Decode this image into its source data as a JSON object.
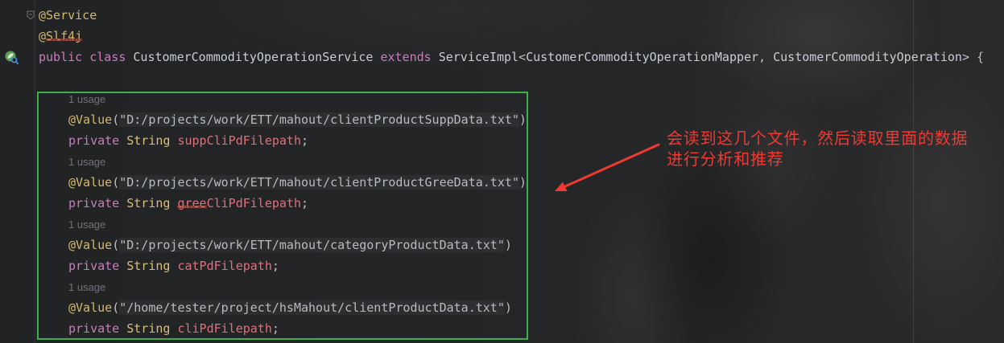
{
  "punct": {
    "lparen": "(",
    "rparen": ")",
    "semicolon": ";",
    "lt": "<",
    "gt": ">",
    "comma": ","
  },
  "header": {
    "annotation_service": "@Service",
    "annotation_slf4j": "@Slf4j",
    "kw_public": "public",
    "kw_class": "class",
    "class_name": "CustomerCommodityOperationService",
    "kw_extends": "extends",
    "super_class": "ServiceImpl",
    "type_arg_mapper": "CustomerCommodityOperationMapper",
    "type_arg_entity": "CustomerCommodityOperation",
    "open_brace": "{"
  },
  "fields": [
    {
      "usage": "1 usage",
      "annotation": "@Value",
      "value_literal": "\"D:/projects/work/ETT/mahout/clientProductSuppData.txt\"",
      "modifier": "private",
      "type": "String",
      "name": "suppCliPdFilepath"
    },
    {
      "usage": "1 usage",
      "annotation": "@Value",
      "value_literal": "\"D:/projects/work/ETT/mahout/clientProductGreeData.txt\"",
      "modifier": "private",
      "type": "String",
      "name": "greeCliPdFilepath"
    },
    {
      "usage": "1 usage",
      "annotation": "@Value",
      "value_literal": "\"D:/projects/work/ETT/mahout/categoryProductData.txt\"",
      "modifier": "private",
      "type": "String",
      "name": "catPdFilepath"
    },
    {
      "usage": "1 usage",
      "annotation": "@Value",
      "value_literal": "\"/home/tester/project/hsMahout/clientProductData.txt\"",
      "modifier": "private",
      "type": "String",
      "name": "cliPdFilepath"
    }
  ],
  "callout": {
    "line1": "会读到这几个文件，然后读取里面的数据",
    "line2": "进行分析和推荐"
  },
  "icons": {
    "gutter_class_line": "spring-bean-icon",
    "gutter_fold": "fold-marker-icon"
  },
  "colors": {
    "annotation": "#D2B96E",
    "keyword": "#C77DBB",
    "class_name": "#C9CDD4",
    "type": "#D9BE7C",
    "field": "#E0707A",
    "string": "#B7BBC2",
    "punctuation": "#BCBEC4",
    "usage_hint": "#6F737A",
    "highlight_box": "#3FAE4C",
    "callout": "#EE3A33"
  }
}
